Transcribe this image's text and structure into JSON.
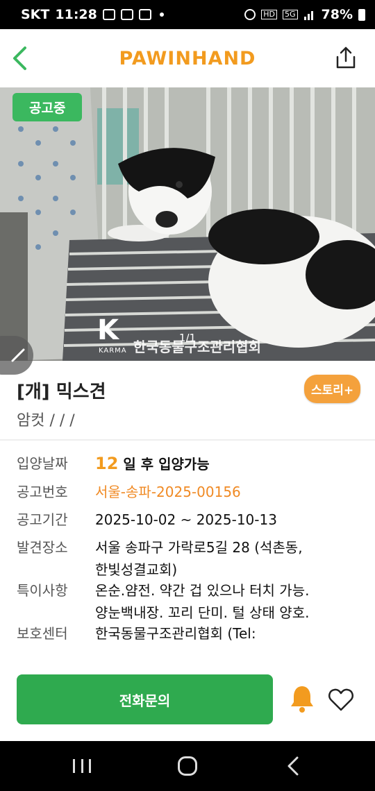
{
  "status_bar": {
    "carrier": "SKT",
    "time": "11:28",
    "battery": "78%",
    "hd_label": "HD",
    "network": "5G"
  },
  "header": {
    "brand": "PAWINHAND",
    "back_icon": "chevron-left-icon",
    "share_icon": "share-icon"
  },
  "photo": {
    "status_badge": "공고중",
    "counter": "1/1",
    "watermark_logo": "K",
    "watermark_brand": "KARMA",
    "watermark_org": "한국동물구조관리협회"
  },
  "animal": {
    "title": "[개] 믹스견",
    "subtitle": "암컷 /  /  /",
    "story_button": "스토리+"
  },
  "info": {
    "adopt_label": "입양날짜",
    "adopt_days": "12",
    "adopt_suffix": "일 후 입양가능",
    "notice_label": "공고번호",
    "notice_value": "서울-송파-2025-00156",
    "period_label": "공고기간",
    "period_value": "2025-10-02 ~ 2025-10-13",
    "found_label": "발견장소",
    "found_value_1": "서울 송파구 가락로5길 28 (석촌동,",
    "found_value_2": "한빛성결교회)",
    "special_label": "특이사항",
    "special_value_1": "온순.얌전. 약간 겁 있으나 터치 가능.",
    "special_value_2": "양눈백내장. 꼬리 단미. 털 상태 양호.",
    "center_label": "보호센터",
    "center_value": "한국동물구조관리협회 (Tel:"
  },
  "actions": {
    "call_button": "전화문의",
    "bell_icon": "bell-icon",
    "heart_icon": "heart-icon"
  },
  "colors": {
    "brand_orange": "#f29b1f",
    "green": "#2faa4f",
    "badge_green": "#3bb85f",
    "story_orange": "#f4a13c"
  }
}
